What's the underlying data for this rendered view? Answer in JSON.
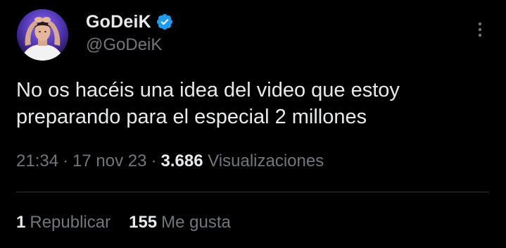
{
  "tweet": {
    "author": {
      "display_name": "GoDeiK",
      "handle": "@GoDeiK",
      "verified": true,
      "verified_color": "#1d9bf0"
    },
    "text": "No os hacéis una idea del video que estoy\npreparando para el especial 2 millones",
    "time": "21:34",
    "date": "17 nov 23",
    "separator": "·",
    "views_count": "3.686",
    "views_label": "Visualizaciones",
    "reposts_count": "1",
    "reposts_label": "Republicar",
    "likes_count": "155",
    "likes_label": "Me gusta"
  },
  "icons": {
    "more": "more-vertical-icon",
    "verified": "verified-badge-icon"
  },
  "colors": {
    "background": "#000000",
    "primary_text": "#e7e9ea",
    "secondary_text": "#71767b",
    "divider": "#2f3336"
  }
}
